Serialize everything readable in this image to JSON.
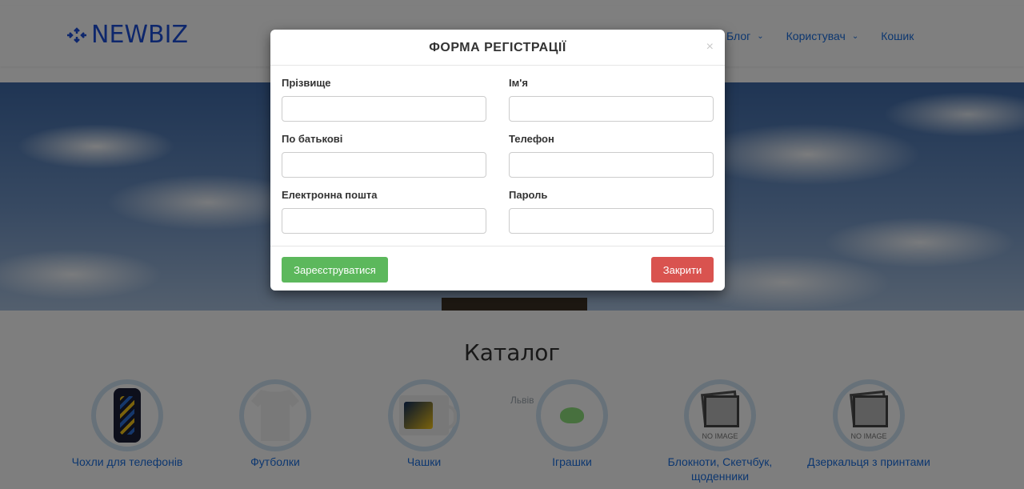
{
  "header": {
    "logo_text": "NEWBIZ",
    "logo_icon": "newbiz-logo-icon",
    "nav": [
      {
        "label": "Блог",
        "has_dropdown": true
      },
      {
        "label": "Користувач",
        "has_dropdown": true
      },
      {
        "label": "Кошик",
        "has_dropdown": false
      }
    ]
  },
  "catalog": {
    "title": "Каталог",
    "map_label": "Львів",
    "no_image_text": "NO IMAGE",
    "items": [
      {
        "label": "Чохли для телефонів",
        "icon": "phone-case-image"
      },
      {
        "label": "Футболки",
        "icon": "tshirt-image"
      },
      {
        "label": "Чашки",
        "icon": "mug-image"
      },
      {
        "label": "Іграшки",
        "icon": "toy-image"
      },
      {
        "label": "Блокноти, Скетчбук, щоденники",
        "icon": "no-image-placeholder"
      },
      {
        "label": "Дзеркальця з принтами",
        "icon": "no-image-placeholder"
      }
    ]
  },
  "modal": {
    "title": "ФОРМА РЕГІСТРАЦІЇ",
    "close_symbol": "×",
    "fields": {
      "surname": {
        "label": "Прізвище",
        "value": ""
      },
      "first_name": {
        "label": "Ім'я",
        "value": ""
      },
      "patronymic": {
        "label": "По батькові",
        "value": ""
      },
      "phone": {
        "label": "Телефон",
        "value": ""
      },
      "email": {
        "label": "Електронна пошта",
        "value": ""
      },
      "password": {
        "label": "Пароль",
        "value": ""
      }
    },
    "register_button": "Зареєструватися",
    "close_button": "Закрити"
  },
  "colors": {
    "brand": "#1d4ed8",
    "link": "#1a6fe0",
    "success": "#5cb85c",
    "danger": "#d9534f",
    "overlay": "rgba(0,0,0,0.5)"
  }
}
